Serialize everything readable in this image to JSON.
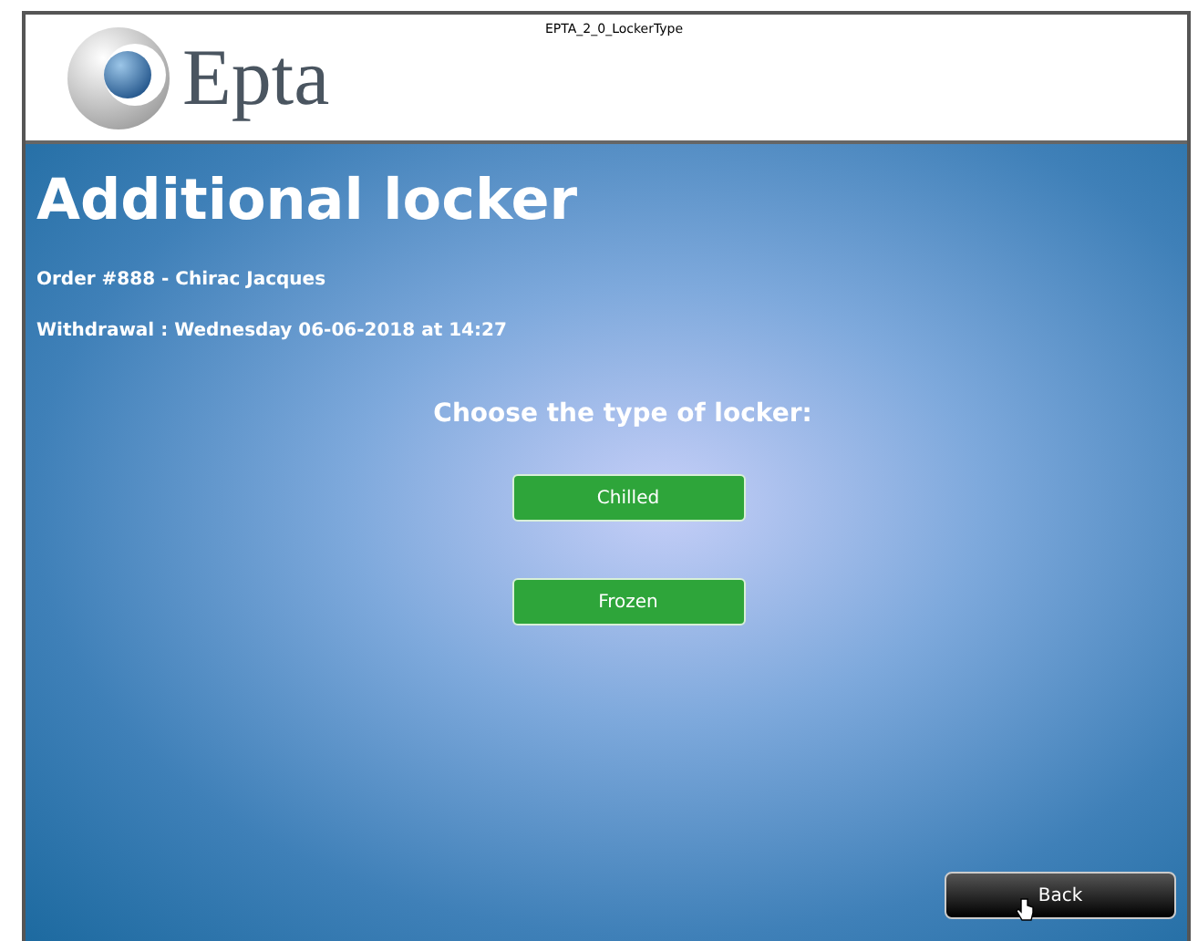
{
  "window": {
    "title": "EPTA_2_0_LockerType"
  },
  "logo": {
    "text": "Epta"
  },
  "heading": "Additional locker",
  "order": "Order #888 - Chirac Jacques",
  "withdrawal": "Withdrawal : Wednesday 06-06-2018 at 14:27",
  "prompt": "Choose the type of locker:",
  "options": [
    {
      "label": "Chilled"
    },
    {
      "label": "Frozen"
    }
  ],
  "back_button": {
    "label": "Back"
  }
}
